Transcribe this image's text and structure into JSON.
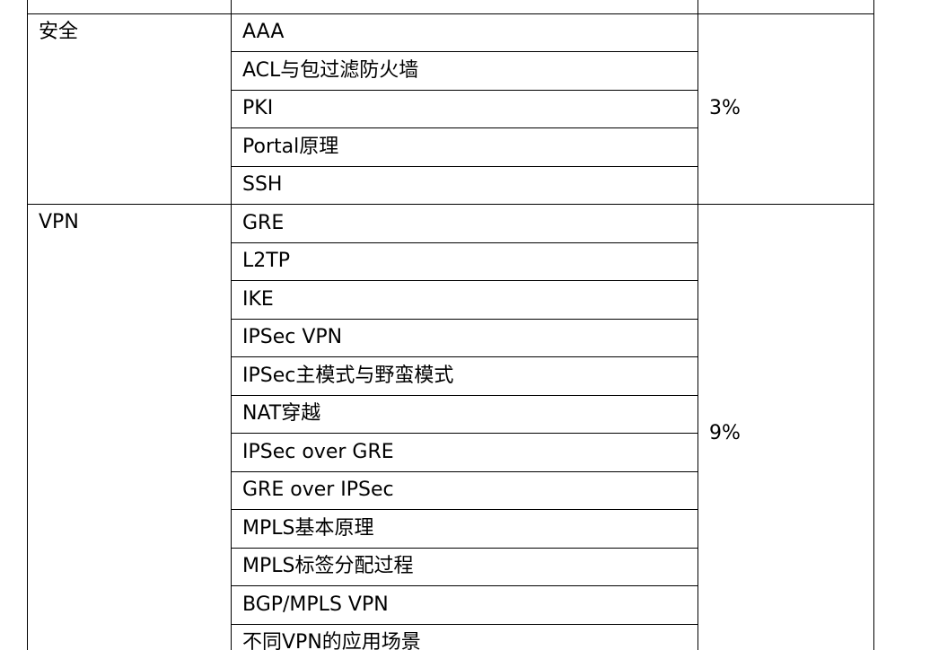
{
  "table": {
    "sections": [
      {
        "category": "安全",
        "weight": "3%",
        "topics": [
          "AAA",
          "ACL与包过滤防火墙",
          "PKI",
          "Portal原理",
          "SSH"
        ]
      },
      {
        "category": "VPN",
        "weight": "9%",
        "topics": [
          "GRE",
          "L2TP",
          "IKE",
          "IPSec VPN",
          "IPSec主模式与野蛮模式",
          "NAT穿越",
          "IPSec over GRE",
          "GRE over IPSec",
          "MPLS基本原理",
          "MPLS标签分配过程",
          "BGP/MPLS VPN",
          "不同VPN的应用场景"
        ]
      }
    ]
  }
}
